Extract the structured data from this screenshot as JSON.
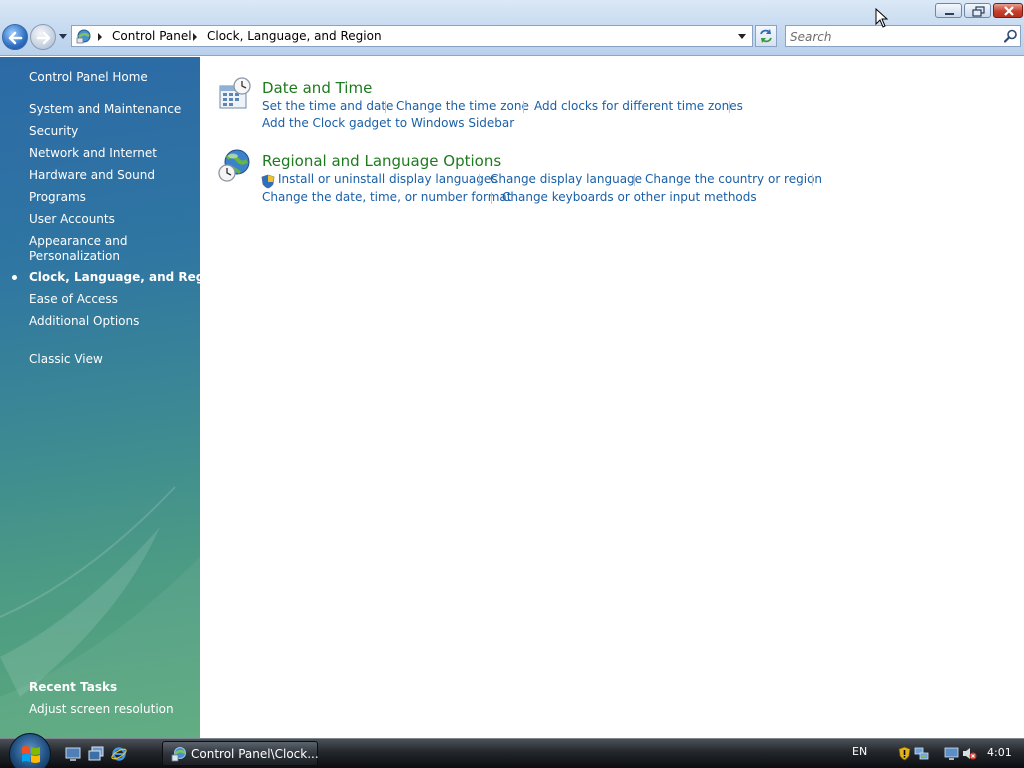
{
  "window": {
    "buttons": {
      "minimize_icon": "minimize-icon",
      "maximize_icon": "restore-icon",
      "close_icon": "close-icon"
    }
  },
  "address_bar": {
    "crumbs": [
      "Control Panel",
      "Clock, Language, and Region"
    ],
    "location_icon": "control-panel-icon"
  },
  "search": {
    "placeholder": "Search"
  },
  "sidebar": {
    "home": "Control Panel Home",
    "items": [
      {
        "label": "System and Maintenance"
      },
      {
        "label": "Security"
      },
      {
        "label": "Network and Internet"
      },
      {
        "label": "Hardware and Sound"
      },
      {
        "label": "Programs"
      },
      {
        "label": "User Accounts"
      },
      {
        "label": "Appearance and Personalization"
      },
      {
        "label": "Clock, Language, and Region",
        "current": true
      },
      {
        "label": "Ease of Access"
      },
      {
        "label": "Additional Options"
      }
    ],
    "classic_view": "Classic View",
    "recent_tasks": {
      "heading": "Recent Tasks",
      "items": [
        "Adjust screen resolution"
      ]
    }
  },
  "categories": [
    {
      "title": "Date and Time",
      "icon": "calendar-clock-icon",
      "tasks": [
        "Set the time and date",
        "Change the time zone",
        "Add clocks for different time zones",
        "Add the Clock gadget to Windows Sidebar"
      ]
    },
    {
      "title": "Regional and Language Options",
      "icon": "globe-clock-icon",
      "tasks": [
        "Install or uninstall display languages",
        "Change display language",
        "Change the country or region",
        "Change the date, time, or number format",
        "Change keyboards or other input methods"
      ]
    }
  ],
  "taskbar": {
    "start_icon": "windows-logo-icon",
    "quick_launch": [
      "show-desktop-icon",
      "switch-windows-icon",
      "internet-explorer-icon"
    ],
    "active_window": "Control Panel\\Clock...",
    "language": "EN",
    "tray_icons": [
      "security-alert-icon",
      "network-icon",
      "display-icon",
      "volume-muted-icon"
    ],
    "time": "4:01"
  }
}
